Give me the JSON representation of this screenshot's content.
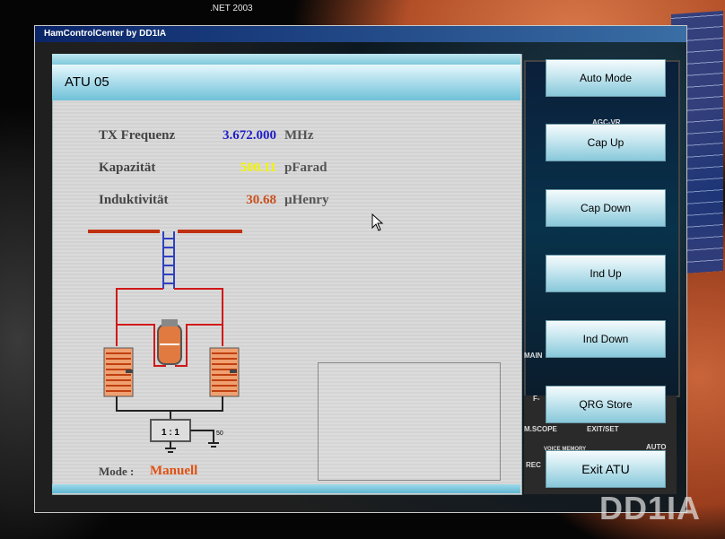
{
  "desktop": {
    "framework_label": ".NET 2003",
    "watermark": "DD1IA"
  },
  "window": {
    "title": "HamControlCenter   by DD1IA"
  },
  "atu": {
    "header": "ATU 05",
    "rows": [
      {
        "label": "TX Frequenz",
        "value": "3.672.000",
        "unit": "MHz",
        "value_color": "#1e1ec8"
      },
      {
        "label": "Kapazität",
        "value": "500.11",
        "unit": "pFarad",
        "value_color": "#f4f400"
      },
      {
        "label": "Induktivität",
        "value": "30.68",
        "unit": "µHenry",
        "value_color": "#c8501e"
      }
    ],
    "mode_label": "Mode :",
    "mode_value": "Manuell",
    "mode_color": "#e05010",
    "diagram": {
      "transformer_label": "1 : 1",
      "impedance_label": "50"
    }
  },
  "buttons": [
    {
      "id": "auto-mode",
      "label": "Auto Mode"
    },
    {
      "id": "cap-up",
      "label": "Cap Up"
    },
    {
      "id": "cap-down",
      "label": "Cap Down"
    },
    {
      "id": "ind-up",
      "label": "Ind Up"
    },
    {
      "id": "ind-down",
      "label": "Ind Down"
    },
    {
      "id": "qrg-store",
      "label": "QRG Store"
    },
    {
      "id": "exit-atu",
      "label": "Exit ATU"
    }
  ],
  "radio": {
    "labels": [
      "AGC-VR",
      "M.SCOPE",
      "EXIT/SET",
      "VOICE MEMORY",
      "AUTO",
      "REC",
      "MAIN",
      "F-"
    ]
  }
}
